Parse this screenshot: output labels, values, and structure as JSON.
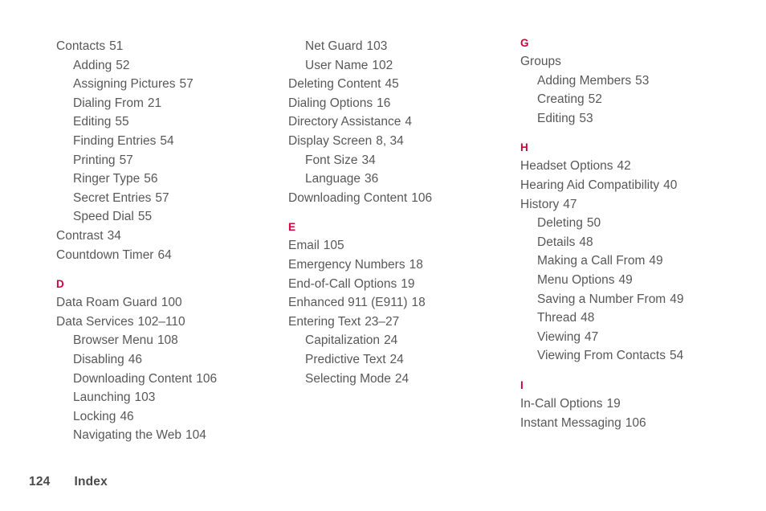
{
  "document": {
    "type": "index-page",
    "accent_color": "#d1003c",
    "text_color": "#58585a",
    "footer_color": "#4b4b4d",
    "background_color": "#ffffff"
  },
  "footer": {
    "page_number": "124",
    "label": "Index"
  },
  "columns": [
    {
      "id": "column-1",
      "blocks": [
        {
          "heading": null,
          "entries": [
            {
              "level": 1,
              "text": "Contacts",
              "page": "51"
            },
            {
              "level": 2,
              "text": "Adding",
              "page": "52"
            },
            {
              "level": 2,
              "text": "Assigning Pictures",
              "page": "57"
            },
            {
              "level": 2,
              "text": "Dialing From",
              "page": "21"
            },
            {
              "level": 2,
              "text": "Editing",
              "page": "55"
            },
            {
              "level": 2,
              "text": "Finding Entries",
              "page": "54"
            },
            {
              "level": 2,
              "text": "Printing",
              "page": "57"
            },
            {
              "level": 2,
              "text": "Ringer Type",
              "page": "56"
            },
            {
              "level": 2,
              "text": "Secret Entries",
              "page": "57"
            },
            {
              "level": 2,
              "text": "Speed Dial",
              "page": "55"
            },
            {
              "level": 1,
              "text": "Contrast",
              "page": "34"
            },
            {
              "level": 1,
              "text": "Countdown Timer",
              "page": "64"
            }
          ]
        },
        {
          "heading": "D",
          "entries": [
            {
              "level": 1,
              "text": "Data Roam Guard",
              "page": "100"
            },
            {
              "level": 1,
              "text": "Data Services",
              "page": "102–110"
            },
            {
              "level": 2,
              "text": "Browser Menu",
              "page": "108"
            },
            {
              "level": 2,
              "text": "Disabling",
              "page": "46"
            },
            {
              "level": 2,
              "text": "Downloading Content",
              "page": "106"
            },
            {
              "level": 2,
              "text": "Launching",
              "page": "103"
            },
            {
              "level": 2,
              "text": "Locking",
              "page": "46"
            },
            {
              "level": 2,
              "text": "Navigating the Web",
              "page": "104"
            }
          ]
        }
      ]
    },
    {
      "id": "column-2",
      "blocks": [
        {
          "heading": null,
          "entries": [
            {
              "level": 2,
              "text": "Net Guard",
              "page": "103"
            },
            {
              "level": 2,
              "text": "User Name",
              "page": "102"
            },
            {
              "level": 1,
              "text": "Deleting Content",
              "page": "45"
            },
            {
              "level": 1,
              "text": "Dialing Options",
              "page": "16"
            },
            {
              "level": 1,
              "text": "Directory Assistance",
              "page": "4"
            },
            {
              "level": 1,
              "text": "Display Screen",
              "page": "8, 34"
            },
            {
              "level": 2,
              "text": "Font Size",
              "page": "34"
            },
            {
              "level": 2,
              "text": "Language",
              "page": "36"
            },
            {
              "level": 1,
              "text": "Downloading Content",
              "page": "106"
            }
          ]
        },
        {
          "heading": "E",
          "entries": [
            {
              "level": 1,
              "text": "Email",
              "page": "105"
            },
            {
              "level": 1,
              "text": "Emergency Numbers",
              "page": "18"
            },
            {
              "level": 1,
              "text": "End-of-Call Options",
              "page": "19"
            },
            {
              "level": 1,
              "text": "Enhanced 911 (E911)",
              "page": "18"
            },
            {
              "level": 1,
              "text": "Entering Text",
              "page": "23–27"
            },
            {
              "level": 2,
              "text": "Capitalization",
              "page": "24"
            },
            {
              "level": 2,
              "text": "Predictive Text",
              "page": "24"
            },
            {
              "level": 2,
              "text": "Selecting Mode",
              "page": "24"
            }
          ]
        }
      ]
    },
    {
      "id": "column-3",
      "blocks": [
        {
          "heading": "G",
          "entries": [
            {
              "level": 1,
              "text": "Groups",
              "page": ""
            },
            {
              "level": 2,
              "text": "Adding Members",
              "page": "53"
            },
            {
              "level": 2,
              "text": "Creating",
              "page": "52"
            },
            {
              "level": 2,
              "text": "Editing",
              "page": "53"
            }
          ]
        },
        {
          "heading": "H",
          "entries": [
            {
              "level": 1,
              "text": "Headset Options",
              "page": "42"
            },
            {
              "level": 1,
              "text": "Hearing Aid Compatibility",
              "page": "40"
            },
            {
              "level": 1,
              "text": "History",
              "page": "47"
            },
            {
              "level": 2,
              "text": "Deleting",
              "page": "50"
            },
            {
              "level": 2,
              "text": "Details",
              "page": "48"
            },
            {
              "level": 2,
              "text": "Making a Call From",
              "page": "49"
            },
            {
              "level": 2,
              "text": "Menu Options",
              "page": "49"
            },
            {
              "level": 2,
              "text": "Saving a Number From",
              "page": "49"
            },
            {
              "level": 2,
              "text": "Thread",
              "page": "48"
            },
            {
              "level": 2,
              "text": "Viewing",
              "page": "47"
            },
            {
              "level": 2,
              "text": "Viewing From Contacts",
              "page": "54"
            }
          ]
        },
        {
          "heading": "I",
          "entries": [
            {
              "level": 1,
              "text": "In-Call Options",
              "page": "19"
            },
            {
              "level": 1,
              "text": "Instant Messaging",
              "page": "106"
            }
          ]
        }
      ]
    }
  ]
}
